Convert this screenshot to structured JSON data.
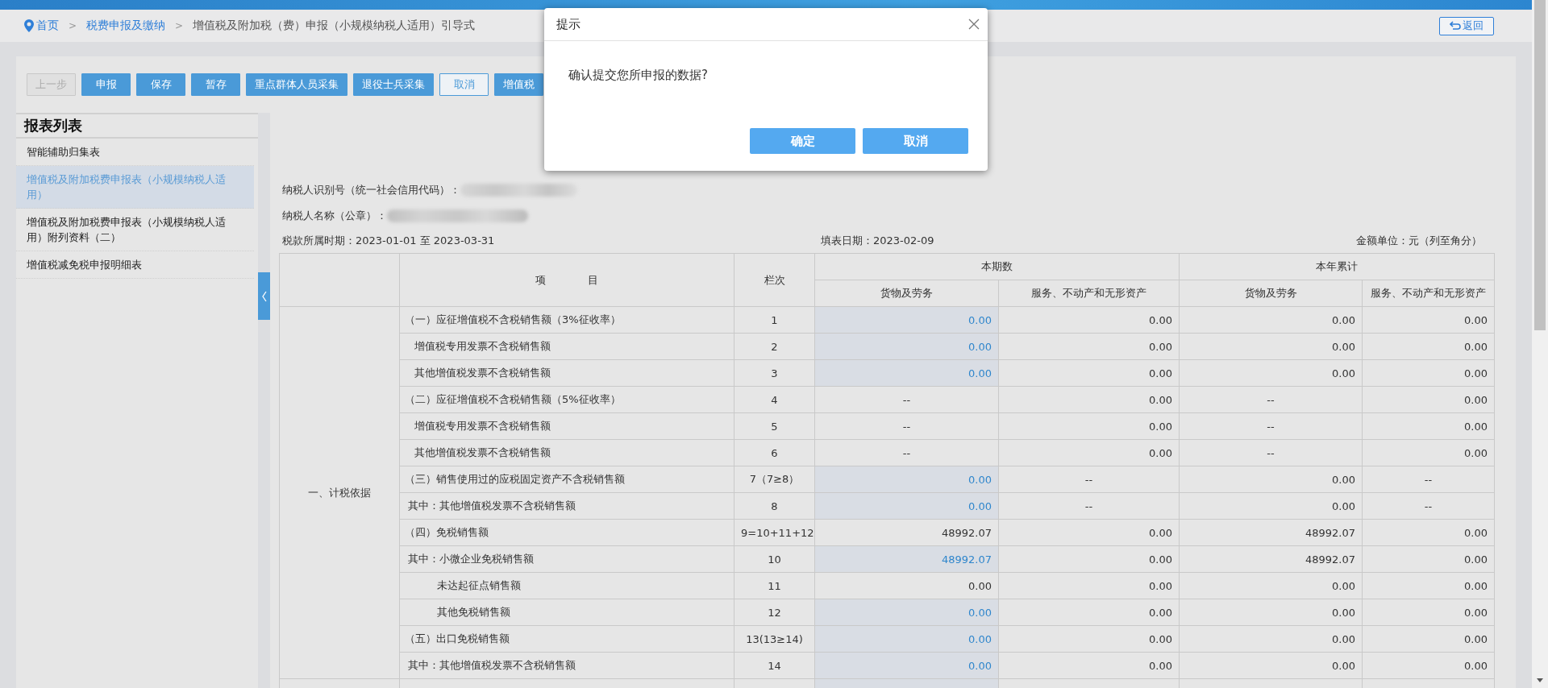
{
  "breadcrumb": [
    {
      "kind": "home",
      "label": "首页"
    },
    {
      "kind": "separator",
      "label": ">"
    },
    {
      "kind": "link",
      "label": "税费申报及缴纳"
    },
    {
      "kind": "separator",
      "label": ">"
    },
    {
      "kind": "current",
      "label": "增值税及附加税（费）申报（小规模纳税人适用）引导式"
    }
  ],
  "back_button": {
    "label": "返回"
  },
  "toolbar": [
    {
      "label": "上一步",
      "kind": "filled",
      "disabled": true
    },
    {
      "label": "申报",
      "kind": "filled",
      "disabled": false
    },
    {
      "label": "保存",
      "kind": "filled",
      "disabled": false
    },
    {
      "label": "暂存",
      "kind": "filled",
      "disabled": false
    },
    {
      "label": "重点群体人员采集",
      "kind": "filled",
      "disabled": false
    },
    {
      "label": "退役士兵采集",
      "kind": "filled",
      "disabled": false
    },
    {
      "label": "取消",
      "kind": "outline",
      "disabled": false
    },
    {
      "label": "增值税",
      "kind": "filled",
      "disabled": false
    }
  ],
  "sidebar": {
    "title": "报表列表",
    "items": [
      {
        "label": "智能辅助归集表",
        "selected": false
      },
      {
        "label": "增值税及附加税费申报表（小规模纳税人适用）",
        "selected": true
      },
      {
        "label": "增值税及附加税费申报表（小规模纳税人适用）附列资料（二）",
        "selected": false
      },
      {
        "label": "增值税减免税申报明细表",
        "selected": false
      }
    ]
  },
  "form": {
    "taxpayer_id_label": "纳税人识别号（统一社会信用代码）：",
    "taxpayer_name_label": "纳税人名称（公章）：",
    "period": "税款所属时期：2023-01-01 至 2023-03-31",
    "fill_date": "填表日期：2023-02-09",
    "unit": "金额单位：元（列至角分）"
  },
  "table": {
    "item_header": "项　　　　目",
    "line_header": "栏次",
    "groups": [
      "本期数",
      "本年累计"
    ],
    "subcolumns": [
      "货物及劳务",
      "服务、不动产和无形资产",
      "货物及劳务",
      "服务、不动产和无形资产"
    ],
    "category": "一、计税依据",
    "rows": [
      {
        "item": "（一）应征增值税不含税销售额（3%征收率）",
        "kind": "section",
        "line": "1",
        "values": [
          {
            "text": "0.00",
            "editable": true
          },
          {
            "text": "0.00",
            "editable": false
          },
          {
            "text": "0.00",
            "editable": false
          },
          {
            "text": "0.00",
            "editable": false
          }
        ]
      },
      {
        "item": "增值税专用发票不含税销售额",
        "kind": "sub",
        "line": "2",
        "values": [
          {
            "text": "0.00",
            "editable": true
          },
          {
            "text": "0.00",
            "editable": false
          },
          {
            "text": "0.00",
            "editable": false
          },
          {
            "text": "0.00",
            "editable": false
          }
        ]
      },
      {
        "item": "其他增值税发票不含税销售额",
        "kind": "sub",
        "line": "3",
        "values": [
          {
            "text": "0.00",
            "editable": true
          },
          {
            "text": "0.00",
            "editable": false
          },
          {
            "text": "0.00",
            "editable": false
          },
          {
            "text": "0.00",
            "editable": false
          }
        ]
      },
      {
        "item": "（二）应征增值税不含税销售额（5%征收率）",
        "kind": "section",
        "line": "4",
        "values": [
          {
            "text": "--",
            "editable": false
          },
          {
            "text": "0.00",
            "editable": false
          },
          {
            "text": "--",
            "editable": false
          },
          {
            "text": "0.00",
            "editable": false
          }
        ]
      },
      {
        "item": "增值税专用发票不含税销售额",
        "kind": "sub",
        "line": "5",
        "values": [
          {
            "text": "--",
            "editable": false
          },
          {
            "text": "0.00",
            "editable": false
          },
          {
            "text": "--",
            "editable": false
          },
          {
            "text": "0.00",
            "editable": false
          }
        ]
      },
      {
        "item": "其他增值税发票不含税销售额",
        "kind": "sub",
        "line": "6",
        "values": [
          {
            "text": "--",
            "editable": false
          },
          {
            "text": "0.00",
            "editable": false
          },
          {
            "text": "--",
            "editable": false
          },
          {
            "text": "0.00",
            "editable": false
          }
        ]
      },
      {
        "item": "（三）销售使用过的应税固定资产不含税销售额",
        "kind": "section",
        "line": "7（7≥8）",
        "values": [
          {
            "text": "0.00",
            "editable": true
          },
          {
            "text": "--",
            "editable": false
          },
          {
            "text": "0.00",
            "editable": false
          },
          {
            "text": "--",
            "editable": false
          }
        ]
      },
      {
        "item": "其中：其他增值税发票不含税销售额",
        "kind": "note",
        "line": "8",
        "values": [
          {
            "text": "0.00",
            "editable": true
          },
          {
            "text": "--",
            "editable": false
          },
          {
            "text": "0.00",
            "editable": false
          },
          {
            "text": "--",
            "editable": false
          }
        ]
      },
      {
        "item": "（四）免税销售额",
        "kind": "section",
        "line": "9=10+11+12",
        "values": [
          {
            "text": "48992.07",
            "editable": false
          },
          {
            "text": "0.00",
            "editable": false
          },
          {
            "text": "48992.07",
            "editable": false
          },
          {
            "text": "0.00",
            "editable": false
          }
        ]
      },
      {
        "item": "其中：小微企业免税销售额",
        "kind": "note",
        "line": "10",
        "values": [
          {
            "text": "48992.07",
            "editable": true
          },
          {
            "text": "0.00",
            "editable": false
          },
          {
            "text": "48992.07",
            "editable": false
          },
          {
            "text": "0.00",
            "editable": false
          }
        ]
      },
      {
        "item": "未达起征点销售额",
        "kind": "detail",
        "line": "11",
        "values": [
          {
            "text": "0.00",
            "editable": false
          },
          {
            "text": "0.00",
            "editable": false
          },
          {
            "text": "0.00",
            "editable": false
          },
          {
            "text": "0.00",
            "editable": false
          }
        ]
      },
      {
        "item": "其他免税销售额",
        "kind": "detail",
        "line": "12",
        "values": [
          {
            "text": "0.00",
            "editable": true
          },
          {
            "text": "0.00",
            "editable": false
          },
          {
            "text": "0.00",
            "editable": false
          },
          {
            "text": "0.00",
            "editable": false
          }
        ]
      },
      {
        "item": "（五）出口免税销售额",
        "kind": "section",
        "line": "13(13≥14)",
        "values": [
          {
            "text": "0.00",
            "editable": true
          },
          {
            "text": "0.00",
            "editable": false
          },
          {
            "text": "0.00",
            "editable": false
          },
          {
            "text": "0.00",
            "editable": false
          }
        ]
      },
      {
        "item": "其中：其他增值税发票不含税销售额",
        "kind": "note",
        "line": "14",
        "values": [
          {
            "text": "0.00",
            "editable": true
          },
          {
            "text": "0.00",
            "editable": false
          },
          {
            "text": "0.00",
            "editable": false
          },
          {
            "text": "0.00",
            "editable": false
          }
        ]
      }
    ]
  },
  "dialog": {
    "title": "提示",
    "message": "确认提交您所申报的数据?",
    "buttons": [
      "确定",
      "取消"
    ]
  }
}
